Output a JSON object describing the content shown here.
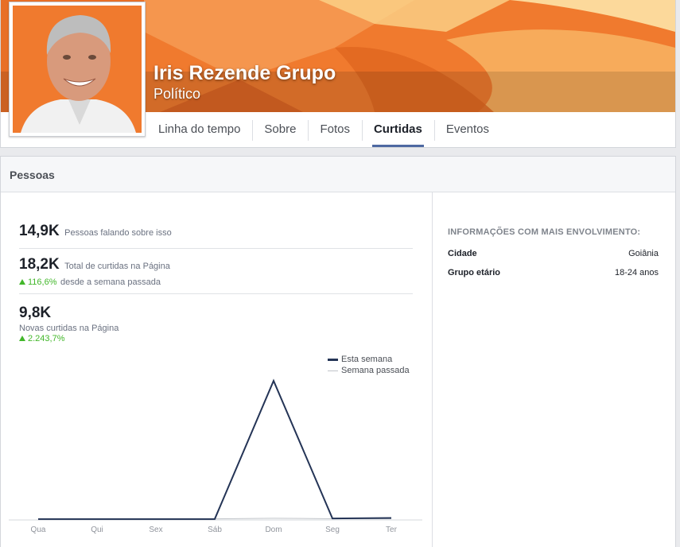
{
  "page": {
    "name": "Iris Rezende Grupo",
    "category": "Político"
  },
  "tabs": [
    {
      "label": "Linha do tempo"
    },
    {
      "label": "Sobre"
    },
    {
      "label": "Fotos"
    },
    {
      "label": "Curtidas",
      "active": true
    },
    {
      "label": "Eventos"
    }
  ],
  "panel": {
    "title": "Pessoas",
    "talking": {
      "value": "14,9K",
      "label": "Pessoas falando sobre isso"
    },
    "total_likes": {
      "value": "18,2K",
      "label": "Total de curtidas na Página",
      "change": "116,6%",
      "change_label": "desde a semana passada"
    },
    "new_likes": {
      "value": "9,8K",
      "label": "Novas curtidas na Página",
      "change": "2.243,7%"
    },
    "legend": {
      "this_week": "Esta semana",
      "last_week": "Semana passada"
    },
    "insights_title": "INFORMAÇÕES COM MAIS ENVOLVIMENTO:",
    "insights": [
      {
        "key": "Cidade",
        "value": "Goiânia"
      },
      {
        "key": "Grupo etário",
        "value": "18-24 anos"
      }
    ]
  },
  "colors": {
    "this_week": "#243456",
    "last_week": "#bfc3c8",
    "positive": "#42b72a",
    "tab_underline": "#4e69a2",
    "cover": "#f07a2e"
  },
  "chart_data": {
    "type": "line",
    "categories": [
      "Qua",
      "Qui",
      "Sex",
      "Sáb",
      "Dom",
      "Seg",
      "Ter"
    ],
    "series": [
      {
        "name": "Esta semana",
        "values": [
          10,
          10,
          10,
          10,
          9400,
          50,
          80
        ]
      },
      {
        "name": "Semana passada",
        "values": [
          20,
          20,
          20,
          20,
          60,
          30,
          30
        ]
      }
    ],
    "ylim": [
      0,
      10800
    ],
    "grid": false,
    "legend": "top-right"
  }
}
